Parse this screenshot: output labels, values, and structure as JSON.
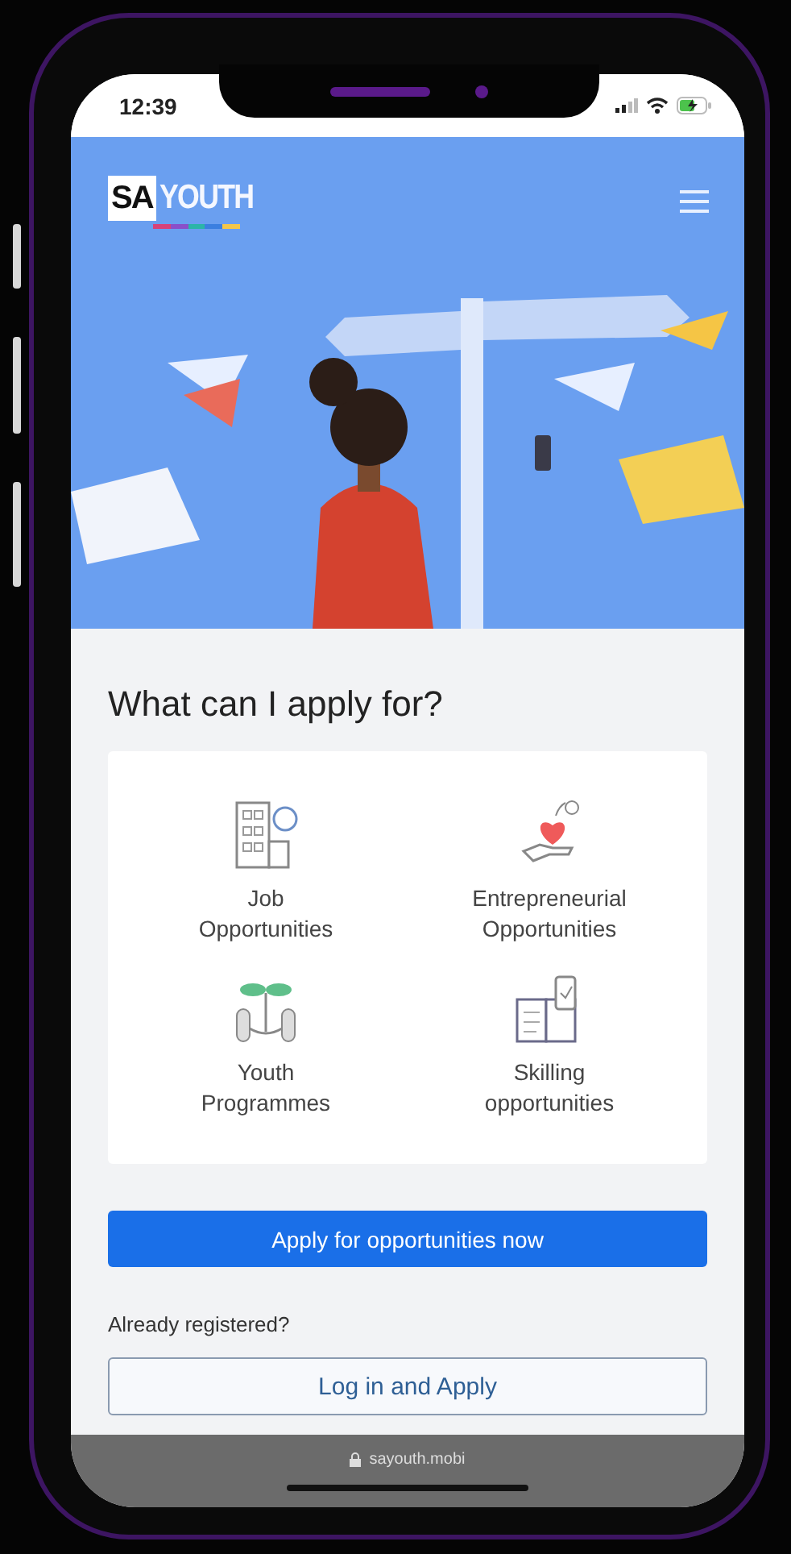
{
  "status_bar": {
    "time": "12:39"
  },
  "header": {
    "logo": {
      "badge": "SA",
      "word": "YOUTH"
    }
  },
  "section": {
    "title": "What can I apply for?",
    "options": [
      {
        "kind": "job",
        "label": [
          "Job",
          "Opportunities"
        ]
      },
      {
        "kind": "business",
        "label": [
          "Entrepreneurial",
          "Opportunities"
        ]
      },
      {
        "kind": "programme",
        "label": [
          "Youth",
          "Programmes"
        ]
      },
      {
        "kind": "skills",
        "label": [
          "Skilling",
          "opportunities"
        ]
      }
    ]
  },
  "primary_button": "Apply for opportunities now",
  "login_prompt": "Already registered?",
  "login_button": "Log in and Apply",
  "address_bar": {
    "url": "sayouth.mobi"
  }
}
